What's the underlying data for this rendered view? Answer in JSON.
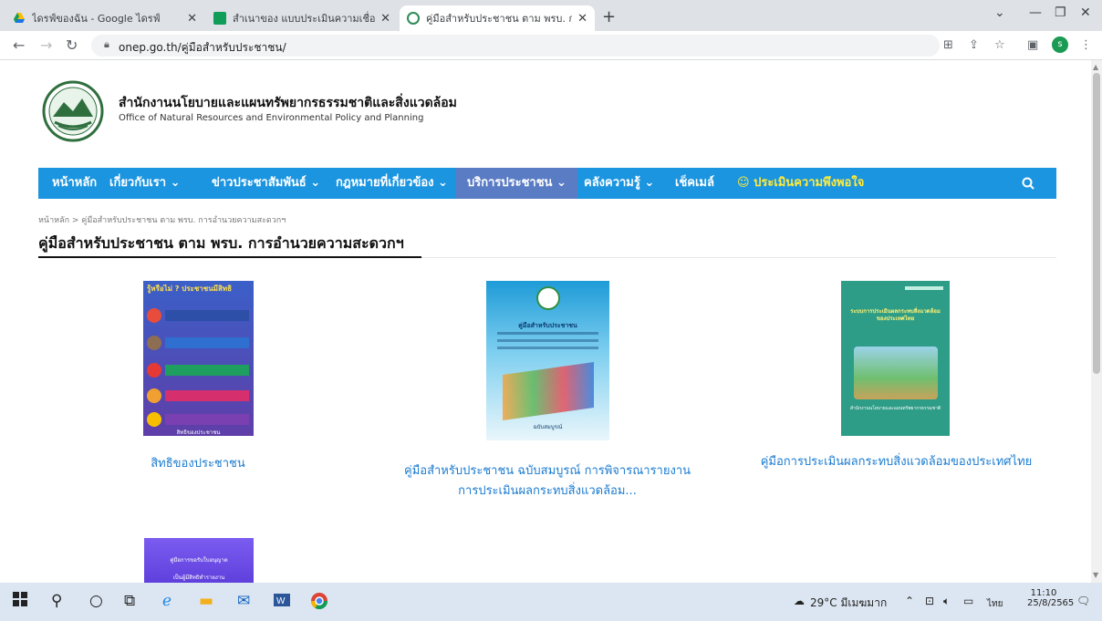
{
  "browser": {
    "tabs": [
      {
        "title": "ไดรฟ์ของฉัน - Google ไดรฟ์",
        "icon": "google-drive-icon",
        "active": false
      },
      {
        "title": "สำเนาของ แบบประเมินความเชื่อมั่นของ",
        "icon": "google-forms-icon",
        "active": false
      },
      {
        "title": "คู่มือสำหรับประชาชน ตาม พรบ. การอำ",
        "icon": "onep-favicon-icon",
        "active": true
      }
    ],
    "url": "onep.go.th/คู่มือสำหรับประชาชน/",
    "profile_initial": "s"
  },
  "site": {
    "org_name_th": "สำนักงานนโยบายและแผนทรัพยากรธรรมชาติและสิ่งแวดล้อม",
    "org_name_en": "Office of Natural Resources and Environmental Policy and Planning",
    "nav": [
      {
        "label": "หน้าหลัก"
      },
      {
        "label": "เกี่ยวกับเรา ⌄"
      },
      {
        "label": "ข่าวประชาสัมพันธ์ ⌄"
      },
      {
        "label": "กฎหมายที่เกี่ยวข้อง ⌄"
      },
      {
        "label": "บริการประชาชน ⌄"
      },
      {
        "label": "คลังความรู้ ⌄"
      },
      {
        "label": "เช็คเมล์"
      },
      {
        "label": "☺ ประเมินความพึงพอใจ"
      }
    ],
    "breadcrumb": "หน้าหลัก  >  คู่มือสำหรับประชาชน ตาม พรบ. การอำนวยความสะดวกฯ",
    "page_title": "คู่มือสำหรับประชาชน ตาม พรบ. การอำนวยความสะดวกฯ",
    "cards": [
      {
        "title_line1": "สิทธิของประชาชน",
        "title_line2": "",
        "cover_heading": "รู้หรือไม่ ? ประชาชนมีสิทธิ",
        "cover_footer": "สิทธิของประชาชน"
      },
      {
        "title_line1": "คู่มือสำหรับประชาชน ฉบับสมบูรณ์ การพิจารณารายงาน",
        "title_line2": "การประเมินผลกระทบสิ่งแวดล้อม...",
        "cover_heading": "คู่มือสำหรับประชาชน",
        "cover_footer": "ฉบับสมบูรณ์"
      },
      {
        "title_line1": "คู่มือการประเมินผลกระทบสิ่งแวดล้อมของประเทศไทย",
        "title_line2": "",
        "cover_heading": "ระบบการประเมินผลกระทบสิ่งแวดล้อม ของประเทศไทย",
        "cover_footer": "สำนักงานนโยบายและแผนทรัพยากรธรรมชาติ"
      },
      {
        "title_line1": "",
        "title_line2": "",
        "cover_heading": "คู่มือการขอรับใบอนุญาต",
        "cover_footer": "เป็นผู้มีสิทธิทำรายงาน"
      }
    ]
  },
  "taskbar": {
    "weather": "29°C มีเมฆมาก",
    "language": "ไทย",
    "time": "11:10",
    "date": "25/8/2565"
  },
  "colors": {
    "nav_bg": "#1b95e0",
    "nav_active": "#5a7cc4",
    "link": "#1a7bd0",
    "highlight": "#ffeb3b"
  }
}
